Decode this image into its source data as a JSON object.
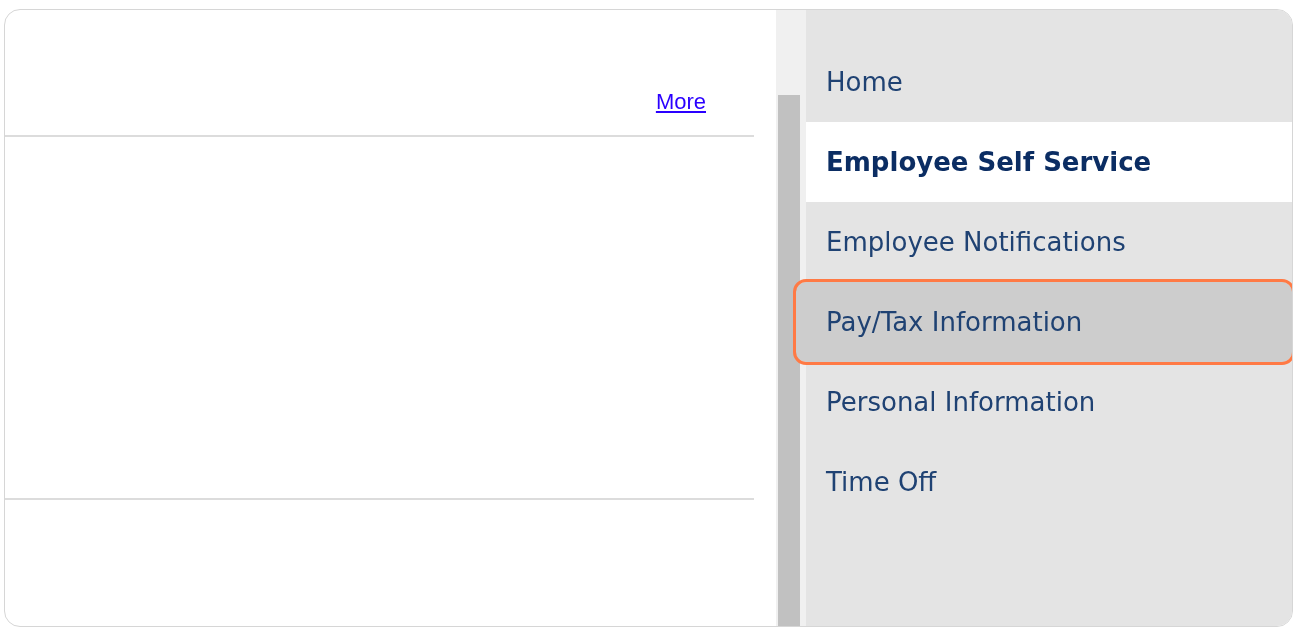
{
  "content": {
    "link": "More"
  },
  "menu": {
    "items": [
      {
        "label": "Home",
        "selected": false,
        "highlighted": false
      },
      {
        "label": "Employee Self Service",
        "selected": true,
        "highlighted": false
      },
      {
        "label": "Employee Notifications",
        "selected": false,
        "highlighted": false
      },
      {
        "label": "Pay/Tax Information",
        "selected": false,
        "highlighted": true
      },
      {
        "label": "Personal Information",
        "selected": false,
        "highlighted": false
      },
      {
        "label": "Time Off",
        "selected": false,
        "highlighted": false
      }
    ]
  }
}
